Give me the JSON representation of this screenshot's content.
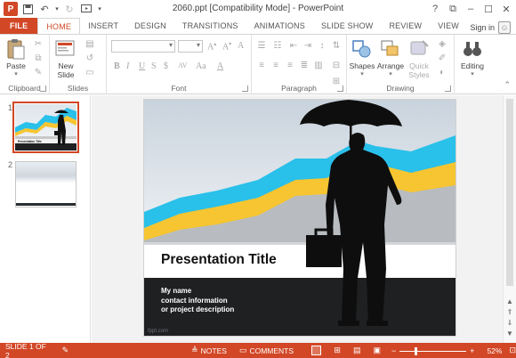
{
  "titlebar": {
    "doc_title": "2060.ppt [Compatibility Mode] - PowerPoint",
    "logo_text": "P",
    "help": "?",
    "restore": "⧉",
    "minimize": "–",
    "maximize": "☐",
    "close": "✕"
  },
  "tabs": [
    {
      "label": "FILE"
    },
    {
      "label": "HOME"
    },
    {
      "label": "INSERT"
    },
    {
      "label": "DESIGN"
    },
    {
      "label": "TRANSITIONS"
    },
    {
      "label": "ANIMATIONS"
    },
    {
      "label": "SLIDE SHOW"
    },
    {
      "label": "REVIEW"
    },
    {
      "label": "VIEW"
    }
  ],
  "signin": "Sign in",
  "ribbon": {
    "clipboard": {
      "label": "Clipboard",
      "paste": "Paste"
    },
    "slides": {
      "label": "Slides",
      "new_slide_line1": "New",
      "new_slide_line2": "Slide"
    },
    "font": {
      "label": "Font"
    },
    "paragraph": {
      "label": "Paragraph"
    },
    "drawing": {
      "label": "Drawing",
      "shapes": "Shapes",
      "arrange": "Arrange",
      "quick_styles_line1": "Quick",
      "quick_styles_line2": "Styles"
    },
    "editing": {
      "label": "Editing"
    }
  },
  "slides_pane": {
    "items": [
      {
        "number": "1"
      },
      {
        "number": "2"
      }
    ],
    "thumb1_title": "Presentation Title"
  },
  "slide": {
    "title": "Presentation Title",
    "lines": [
      "My name",
      "contact information",
      "or project description"
    ],
    "watermark": "fppt.com"
  },
  "statusbar": {
    "slide_info": "SLIDE 1 OF 2",
    "notes": "NOTES",
    "comments": "COMMENTS",
    "zoom": "52%",
    "zoom_fraction": 0.52
  },
  "colors": {
    "accent": "#d24726",
    "chart_cyan": "#29c0ea",
    "chart_yellow": "#f6c531",
    "chart_gray": "#b8bcc0",
    "footer_dark": "#1f2022"
  }
}
